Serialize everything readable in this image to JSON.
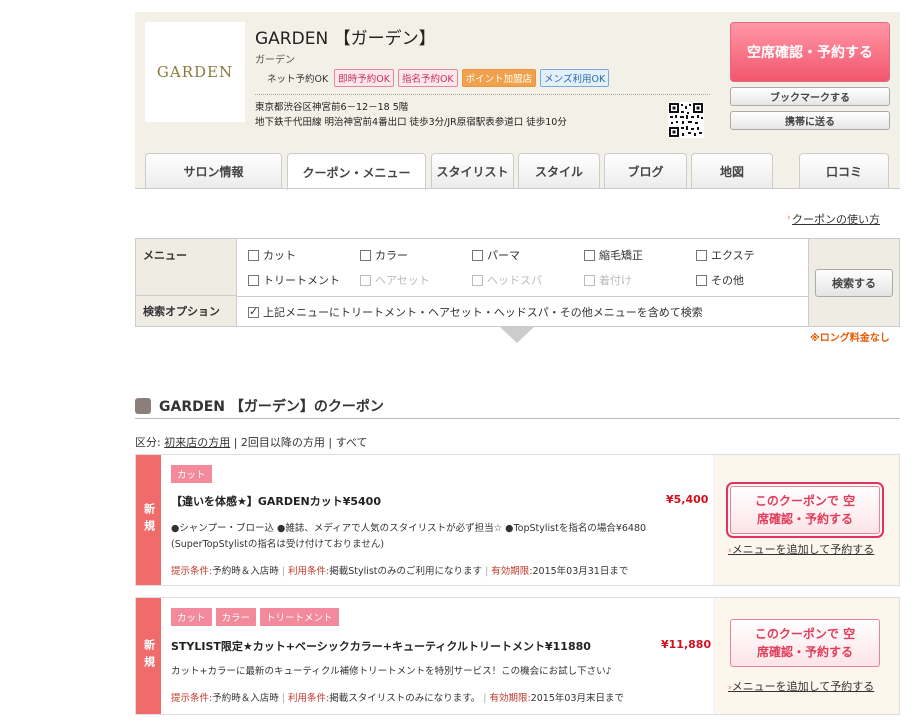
{
  "header": {
    "logo_text": "GARDEN",
    "salon_name": "GARDEN 【ガーデン】",
    "salon_kana": "ガーデン",
    "tags": [
      "ネット予約OK",
      "即時予約OK",
      "指名予約OK",
      "ポイント加盟店",
      "メンズ利用OK"
    ],
    "address": "東京都渋谷区神宮前6－12－18 5階",
    "access": "地下鉄千代田線 明治神宮前4番出口 徒歩3分/JR原宿駅表参道口 徒歩10分",
    "reserve_button": "空席確認・予約する",
    "bookmark_button": "ブックマークする",
    "mobile_button": "携帯に送る"
  },
  "tabs": [
    "サロン情報",
    "クーポン・メニュー",
    "スタイリスト",
    "スタイル",
    "ブログ",
    "地図",
    "口コミ"
  ],
  "search": {
    "howto_link": "クーポンの使い方",
    "menu_label": "メニュー",
    "option_label": "検索オプション",
    "menu_items": [
      {
        "label": "カット",
        "enabled": true
      },
      {
        "label": "カラー",
        "enabled": true
      },
      {
        "label": "パーマ",
        "enabled": true
      },
      {
        "label": "縮毛矯正",
        "enabled": true
      },
      {
        "label": "エクステ",
        "enabled": true
      },
      {
        "label": "トリートメント",
        "enabled": true
      },
      {
        "label": "ヘアセット",
        "enabled": false
      },
      {
        "label": "ヘッドスパ",
        "enabled": false
      },
      {
        "label": "着付け",
        "enabled": false
      },
      {
        "label": "その他",
        "enabled": true
      }
    ],
    "option_text": "上記メニューにトリートメント・ヘアセット・ヘッドスパ・その他メニューを含めて検索",
    "option_checked": true,
    "search_button": "検索する",
    "note": "※ロング料金なし"
  },
  "coupons_section": {
    "title": "GARDEN 【ガーデン】のクーポン",
    "category_label": "区分:",
    "category_first": "初来店の方用",
    "category_rest": "| 2回目以降の方用 | すべて"
  },
  "coupons": [
    {
      "badge": "新規",
      "tags": [
        "カット"
      ],
      "title": "【違いを体感★】GARDENカット¥5400",
      "price": "¥5,400",
      "desc": "●シャンプー・ブロー込 ●雑誌、メディアで人気のスタイリストが必ず担当☆ ●TopStylistを指名の場合¥6480 (SuperTopStylistの指名は受け付けておりません)",
      "cond_label": "提示条件:",
      "cond": "予約時＆入店時",
      "use_label": "利用条件:",
      "use": "掲載Stylistのみのご利用になります",
      "exp_label": "有効期限:",
      "exp": "2015年03月31日まで",
      "button": "このクーポンで 空席確認・予約する",
      "add_link": "メニューを追加して予約する"
    },
    {
      "badge": "新規",
      "tags": [
        "カット",
        "カラー",
        "トリートメント"
      ],
      "title": "STYLIST限定★カット+ベーシックカラー+キューティクルトリートメント¥11880",
      "price": "¥11,880",
      "desc": "カット+カラーに最新のキューティクル補修トリートメントを特別サービス！この機会にお試し下さい♪",
      "cond_label": "提示条件:",
      "cond": "予約時＆入店時",
      "use_label": "利用条件:",
      "use": "掲載スタイリストのみになります。",
      "exp_label": "有効期限:",
      "exp": "2015年03月末日まで",
      "button": "このクーポンで 空席確認・予約する",
      "add_link": "メニューを追加して予約する"
    }
  ]
}
